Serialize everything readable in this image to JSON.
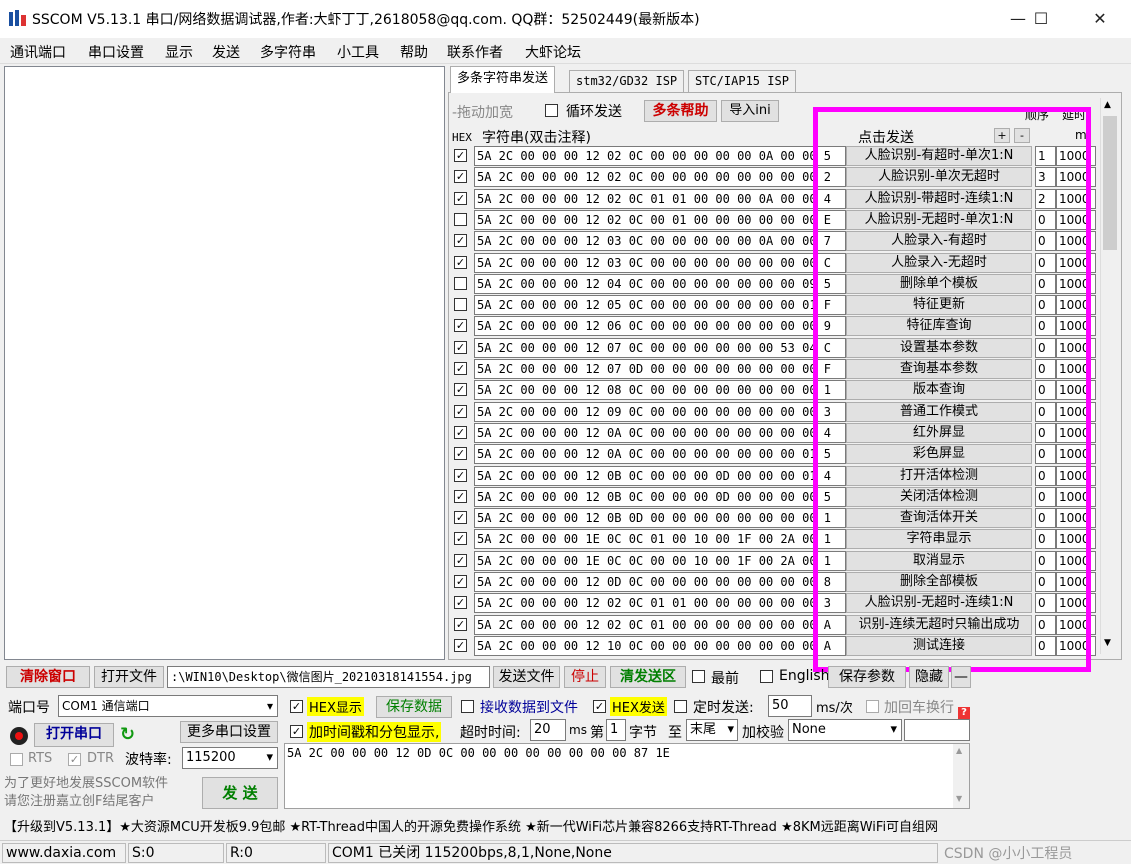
{
  "window": {
    "title": "SSCOM V5.13.1 串口/网络数据调试器,作者:大虾丁丁,2618058@qq.com. QQ群：52502449(最新版本)",
    "minimize": "—",
    "maximize": "☐",
    "close": "✕"
  },
  "menu": [
    "通讯端口",
    "串口设置",
    "显示",
    "发送",
    "多字符串",
    "小工具",
    "帮助",
    "联系作者",
    "大虾论坛"
  ],
  "tabs": [
    "多条字符串发送",
    "stm32/GD32 ISP",
    "STC/IAP15 ISP"
  ],
  "multi": {
    "drag_widen": "-拖动加宽",
    "loop_send": "循环发送",
    "help_btn": "多条帮助",
    "import_btn": "导入ini",
    "order_header": "顺序",
    "delay_header": "延时",
    "hex_header": "HEX",
    "string_header": "字符串(双击注释)",
    "click_send_header": "点击发送",
    "plus": "+",
    "minus": "-",
    "ms_header": "m",
    "rows": [
      {
        "checked": true,
        "hex": "5A 2C 00 00 00 12 02 0C 00 00 00 00 00 0A 00 00 5",
        "label": "人脸识别-有超时-单次1:N",
        "seq": "1",
        "delay": "1000"
      },
      {
        "checked": true,
        "hex": "5A 2C 00 00 00 12 02 0C 00 00 00 00 00 00 00 00 2",
        "label": "人脸识别-单次无超时",
        "seq": "3",
        "delay": "1000"
      },
      {
        "checked": true,
        "hex": "5A 2C 00 00 00 12 02 0C 01 01 00 00 00 0A 00 00 4",
        "label": "人脸识别-带超时-连续1:N",
        "seq": "2",
        "delay": "1000"
      },
      {
        "checked": false,
        "hex": "5A 2C 00 00 00 12 02 0C 00 01 00 00 00 00 00 00 E",
        "label": "人脸识别-无超时-单次1:N",
        "seq": "0",
        "delay": "1000"
      },
      {
        "checked": true,
        "hex": "5A 2C 00 00 00 12 03 0C 00 00 00 00 00 0A 00 00 7",
        "label": "人脸录入-有超时",
        "seq": "0",
        "delay": "1000"
      },
      {
        "checked": true,
        "hex": "5A 2C 00 00 00 12 03 0C 00 00 00 00 00 00 00 00 C",
        "label": "人脸录入-无超时",
        "seq": "0",
        "delay": "1000"
      },
      {
        "checked": false,
        "hex": "5A 2C 00 00 00 12 04 0C 00 00 00 00 00 00 00 09 5",
        "label": "删除单个模板",
        "seq": "0",
        "delay": "1000"
      },
      {
        "checked": false,
        "hex": "5A 2C 00 00 00 12 05 0C 00 00 00 00 00 00 00 01 F",
        "label": "特征更新",
        "seq": "0",
        "delay": "1000"
      },
      {
        "checked": true,
        "hex": "5A 2C 00 00 00 12 06 0C 00 00 00 00 00 00 00 00 9",
        "label": "特征库查询",
        "seq": "0",
        "delay": "1000"
      },
      {
        "checked": true,
        "hex": "5A 2C 00 00 00 12 07 0C 00 00 00 00 00 00 53 04 C",
        "label": "设置基本参数",
        "seq": "0",
        "delay": "1000"
      },
      {
        "checked": true,
        "hex": "5A 2C 00 00 00 12 07 0D 00 00 00 00 00 00 00 00 F",
        "label": "查询基本参数",
        "seq": "0",
        "delay": "1000"
      },
      {
        "checked": true,
        "hex": "5A 2C 00 00 00 12 08 0C 00 00 00 00 00 00 00 00 1",
        "label": "版本查询",
        "seq": "0",
        "delay": "1000"
      },
      {
        "checked": true,
        "hex": "5A 2C 00 00 00 12 09 0C 00 00 00 00 00 00 00 00 3",
        "label": "普通工作模式",
        "seq": "0",
        "delay": "1000"
      },
      {
        "checked": true,
        "hex": "5A 2C 00 00 00 12 0A 0C 00 00 00 00 00 00 00 00 4",
        "label": "红外屏显",
        "seq": "0",
        "delay": "1000"
      },
      {
        "checked": true,
        "hex": "5A 2C 00 00 00 12 0A 0C 00 00 00 00 00 00 00 01 5",
        "label": "彩色屏显",
        "seq": "0",
        "delay": "1000"
      },
      {
        "checked": true,
        "hex": "5A 2C 00 00 00 12 0B 0C 00 00 00 0D 00 00 00 01 4",
        "label": "打开活体检测",
        "seq": "0",
        "delay": "1000"
      },
      {
        "checked": true,
        "hex": "5A 2C 00 00 00 12 0B 0C 00 00 00 0D 00 00 00 00 5",
        "label": "关闭活体检测",
        "seq": "0",
        "delay": "1000"
      },
      {
        "checked": true,
        "hex": "5A 2C 00 00 00 12 0B 0D 00 00 00 00 00 00 00 00 1",
        "label": "查询活体开关",
        "seq": "0",
        "delay": "1000"
      },
      {
        "checked": true,
        "hex": "5A 2C 00 00 00 1E 0C 0C 01 00 10 00 1F 00 2A 00 1",
        "label": "字符串显示",
        "seq": "0",
        "delay": "1000"
      },
      {
        "checked": true,
        "hex": "5A 2C 00 00 00 1E 0C 0C 00 00 10 00 1F 00 2A 00 1",
        "label": "取消显示",
        "seq": "0",
        "delay": "1000"
      },
      {
        "checked": true,
        "hex": "5A 2C 00 00 00 12 0D 0C 00 00 00 00 00 00 00 00 8",
        "label": "删除全部模板",
        "seq": "0",
        "delay": "1000"
      },
      {
        "checked": true,
        "hex": "5A 2C 00 00 00 12 02 0C 01 01 00 00 00 00 00 00 3",
        "label": "人脸识别-无超时-连续1:N",
        "seq": "0",
        "delay": "1000"
      },
      {
        "checked": true,
        "hex": "5A 2C 00 00 00 12 02 0C 01 00 00 00 00 00 00 00 A",
        "label": "识别-连续无超时只输出成功",
        "seq": "0",
        "delay": "1000"
      },
      {
        "checked": true,
        "hex": "5A 2C 00 00 00 12 10 0C 00 00 00 00 00 00 00 00 A",
        "label": "测试连接",
        "seq": "0",
        "delay": "1000"
      }
    ]
  },
  "bottom": {
    "clear_window": "清除窗口",
    "open_file": "打开文件",
    "file_path": ":\\WIN10\\Desktop\\微信图片_20210318141554.jpg",
    "send_file": "发送文件",
    "stop": "停止",
    "clear_send": "清发送区",
    "topmost": "最前",
    "english": "English",
    "save_params": "保存参数",
    "hide": "隐藏",
    "dash": "—",
    "port_label": "端口号",
    "port_value": "COM1 通信端口",
    "hex_display": "HEX显示",
    "save_data": "保存数据",
    "recv_to_file": "接收数据到文件",
    "hex_send": "HEX发送",
    "timed_send": "定时发送:",
    "interval": "50",
    "interval_unit": "ms/次",
    "add_crlf": "加回车换行",
    "open_port": "打开串口",
    "more_settings": "更多串口设置",
    "timestamp": "加时间戳和分包显示,",
    "timeout_label": "超时时间:",
    "timeout_value": "20",
    "timeout_unit": "ms",
    "nth_label": "第",
    "nth_value": "1",
    "byte_label": "字节",
    "to_label": "至",
    "to_value": "末尾",
    "checksum_label": "加校验",
    "checksum_value": "None",
    "rts": "RTS",
    "dtr": "DTR",
    "baud_label": "波特率:",
    "baud_value": "115200",
    "send_area": "5A 2C 00 00 00 12 0D 0C 00 00 00 00 00 00 00 00 87 1E",
    "promo_line1": "为了更好地发展SSCOM软件",
    "promo_line2": "请您注册嘉立创F结尾客户",
    "send_btn": "发 送",
    "ad_banner": "【升级到V5.13.1】★大资源MCU开发板9.9包邮 ★RT-Thread中国人的开源免费操作系统 ★新一代WiFi芯片兼容8266支持RT-Thread ★8KM远距离WiFi可自组网"
  },
  "status": {
    "site": "www.daxia.com",
    "s": "S:0",
    "r": "R:0",
    "port_state": "COM1 已关闭  115200bps,8,1,None,None",
    "watermark": "CSDN @小小工程员"
  },
  "colors": {
    "highlight": "#ff00ff",
    "red_label": "#cc0000",
    "green_label": "#007f00",
    "blue_label": "#000099"
  }
}
